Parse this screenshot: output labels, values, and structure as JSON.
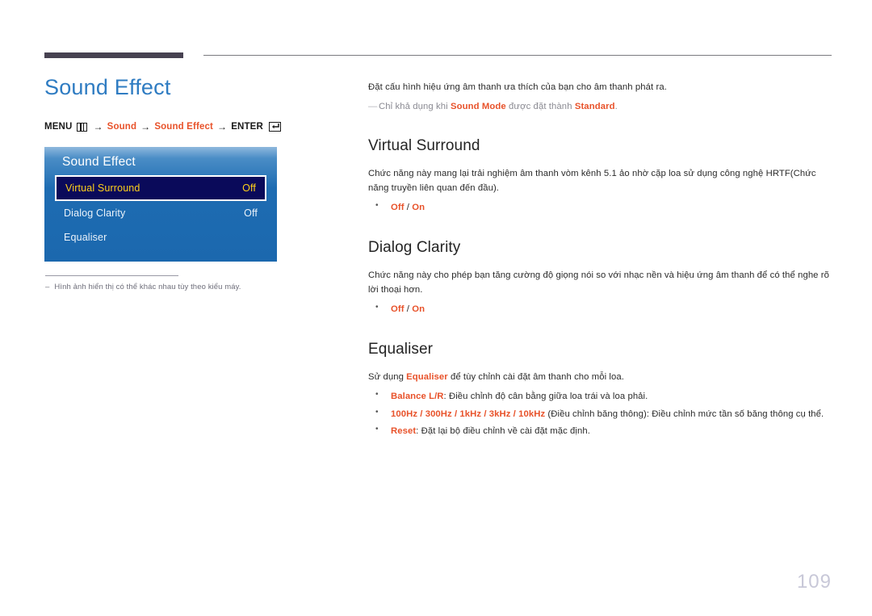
{
  "page": {
    "number": "109"
  },
  "left": {
    "title": "Sound Effect",
    "menu_path": {
      "menu_label": "MENU",
      "menu_icon": "menu-grid-icon",
      "arrow": "→",
      "step1": "Sound",
      "step2": "Sound Effect",
      "enter_label": "ENTER",
      "enter_icon": "enter-return-icon"
    },
    "osd": {
      "title": "Sound Effect",
      "rows": [
        {
          "label": "Virtual Surround",
          "value": "Off",
          "selected": true
        },
        {
          "label": "Dialog Clarity",
          "value": "Off",
          "selected": false
        },
        {
          "label": "Equaliser",
          "value": "",
          "selected": false
        }
      ]
    },
    "footnote": {
      "dash": "–",
      "text": "Hình ảnh hiển thị có thể khác nhau tùy theo kiểu máy."
    }
  },
  "right": {
    "intro": "Đặt cấu hình hiệu ứng âm thanh ưa thích của bạn cho âm thanh phát ra.",
    "note": {
      "dash": "—",
      "part1": "Chỉ khả dụng khi ",
      "bold1": "Sound Mode",
      "part2": " được đặt thành ",
      "bold2": "Standard",
      "part3": "."
    },
    "sections": [
      {
        "heading": "Virtual Surround",
        "body": "Chức năng này mang lại trải nghiệm âm thanh vòm kênh 5.1 ảo nhờ cặp loa sử dụng công nghệ HRTF(Chức năng truyền liên quan đến đầu).",
        "bullets": [
          {
            "bold": "Off",
            "sep": " / ",
            "bold2": "On",
            "rest": ""
          }
        ]
      },
      {
        "heading": "Dialog Clarity",
        "body": "Chức năng này cho phép bạn tăng cường độ giọng nói so với nhạc nền và hiệu ứng âm thanh để có thể nghe rõ lời thoại hơn.",
        "bullets": [
          {
            "bold": "Off",
            "sep": " / ",
            "bold2": "On",
            "rest": ""
          }
        ]
      }
    ],
    "equaliser": {
      "heading": "Equaliser",
      "body_part1": "Sử dụng ",
      "body_bold": "Equaliser",
      "body_part2": " để tùy chỉnh cài đặt âm thanh cho mỗi loa.",
      "bullets": [
        {
          "bold": "Balance L/R",
          "rest": ": Điều chỉnh độ cân bằng giữa loa trái và loa phải."
        },
        {
          "bold": "100Hz / 300Hz / 1kHz / 3kHz / 10kHz",
          "rest": " (Điều chỉnh băng thông): Điều chỉnh mức tần số băng thông cụ thể."
        },
        {
          "bold": "Reset",
          "rest": ": Đặt lại bộ điều chỉnh về cài đặt mặc định."
        }
      ]
    }
  },
  "colors": {
    "title_blue": "#2f7cc2",
    "accent_orange": "#e8522a",
    "osd_blue": "#1e6cb2",
    "osd_selected_bg": "#0a0a5a",
    "osd_selected_text": "#ffd11a",
    "rule_dark": "#474251",
    "page_num": "#c8c8d8"
  }
}
